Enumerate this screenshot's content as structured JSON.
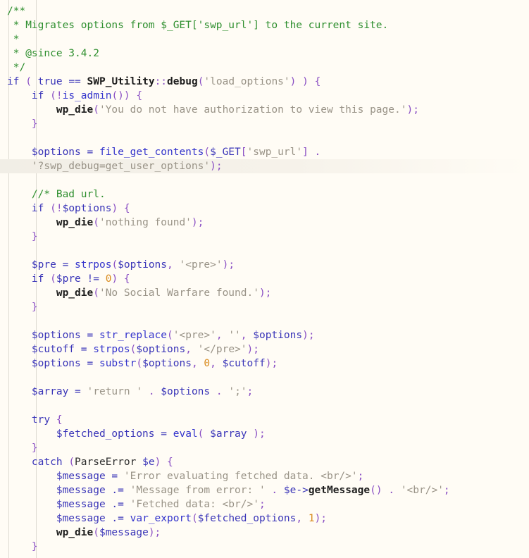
{
  "editor": {
    "language": "php",
    "background_color": "#fffcf5",
    "highlighted_line_number": 12,
    "colors": {
      "comment": "#2f8f2f",
      "keyword": "#3a35b8",
      "builtin_function": "#3434cc",
      "user_function": "#1c1c1c",
      "variable": "#3a35b8",
      "string": "#999387",
      "number": "#d98b1e",
      "punctuation": "#8a4fc4",
      "indent_guide": "#dedad2",
      "line_highlight": "#f1eee6"
    }
  },
  "code": {
    "lines": [
      "/**",
      " * Migrates options from $_GET['swp_url'] to the current site.",
      " *",
      " * @since 3.4.2",
      " */",
      "if ( true == SWP_Utility::debug('load_options') ) {",
      "    if (!is_admin()) {",
      "        wp_die('You do not have authorization to view this page.');",
      "    }",
      "",
      "    $options = file_get_contents($_GET['swp_url'] .",
      "    '?swp_debug=get_user_options');",
      "",
      "    //* Bad url.",
      "    if (!$options) {",
      "        wp_die('nothing found');",
      "    }",
      "",
      "    $pre = strpos($options, '<pre>');",
      "    if ($pre != 0) {",
      "        wp_die('No Social Warfare found.');",
      "    }",
      "",
      "    $options = str_replace('<pre>', '', $options);",
      "    $cutoff = strpos($options, '</pre>');",
      "    $options = substr($options, 0, $cutoff);",
      "",
      "    $array = 'return ' . $options . ';';",
      "",
      "    try {",
      "        $fetched_options = eval( $array );",
      "    }",
      "    catch (ParseError $e) {",
      "        $message = 'Error evaluating fetched data. <br/>';",
      "        $message .= 'Message from error: ' . $e->getMessage() . '<br/>';",
      "        $message .= 'Fetched data: <br/>';",
      "        $message .= var_export($fetched_options, 1);",
      "        wp_die($message);",
      "    }"
    ],
    "docblock": {
      "summary": "Migrates options from $_GET['swp_url'] to the current site.",
      "since": "3.4.2"
    },
    "identifiers": {
      "class": "SWP_Utility",
      "class_method": "debug",
      "debug_flag": "load_options",
      "query_param": "swp_url",
      "debug_query_string": "?swp_debug=get_user_options",
      "open_tag": "<pre>",
      "close_tag": "</pre>",
      "exception_type": "ParseError",
      "exception_var": "$e"
    },
    "messages": {
      "unauthorized": "You do not have authorization to view this page.",
      "nothing_found": "nothing found",
      "not_found": "No Social Warfare found.",
      "eval_error": "Error evaluating fetched data. <br/>",
      "error_prefix": "Message from error: ",
      "fetched_data": "Fetched data: <br/>",
      "line_break": "<br/>"
    },
    "functions": [
      "SWP_Utility::debug",
      "is_admin",
      "wp_die",
      "file_get_contents",
      "strpos",
      "str_replace",
      "substr",
      "eval",
      "var_export",
      "getMessage"
    ],
    "variables": [
      "$options",
      "$pre",
      "$cutoff",
      "$array",
      "$fetched_options",
      "$message",
      "$e"
    ],
    "numbers": [
      "0",
      "1"
    ],
    "comment_bad_url": "//* Bad url."
  }
}
